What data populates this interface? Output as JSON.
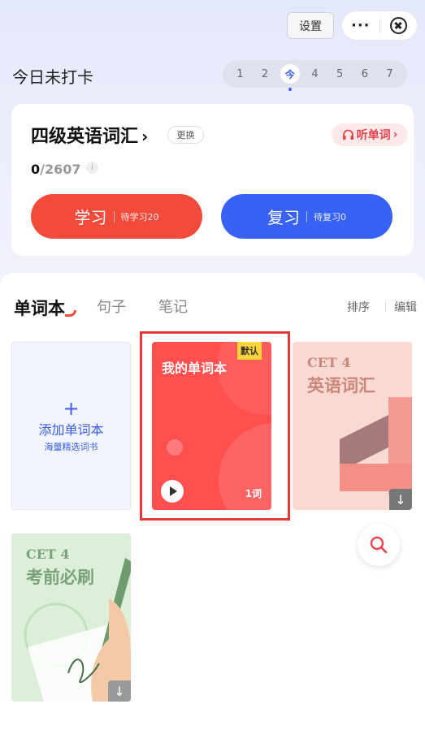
{
  "header": {
    "settings_label": "设置",
    "more_label": "···"
  },
  "checkin": {
    "status": "今日未打卡",
    "days": [
      "1",
      "2",
      "今",
      "4",
      "5",
      "6",
      "7"
    ],
    "today_index": 2
  },
  "card": {
    "book_title": "四级英语词汇",
    "chevron": "›",
    "change_label": "更换",
    "listen_label": "听单词",
    "listen_chevron": "›",
    "progress_done": "0",
    "progress_total": "/2607",
    "info": "i",
    "study": {
      "label": "学习",
      "sub": "待学习20"
    },
    "review": {
      "label": "复习",
      "sub": "待复习0"
    }
  },
  "tabs": [
    "单词本",
    "句子",
    "笔记"
  ],
  "tools": {
    "sort": "排序",
    "edit": "编辑"
  },
  "books": {
    "add": {
      "plus": "+",
      "title": "添加单词本",
      "subtitle": "海量精选词书"
    },
    "mine": {
      "title": "我的单词本",
      "badge": "默认",
      "count": "1词"
    },
    "cet4_vocab": {
      "line1": "CET 4",
      "line2": "英语词汇"
    },
    "cet4_exam": {
      "line1": "CET 4",
      "line2": "考前必刷"
    },
    "download_icon": "↓"
  },
  "colors": {
    "accent_red": "#f24a3b",
    "accent_blue": "#3862f5",
    "brand_blue_text": "#3a5df0"
  }
}
